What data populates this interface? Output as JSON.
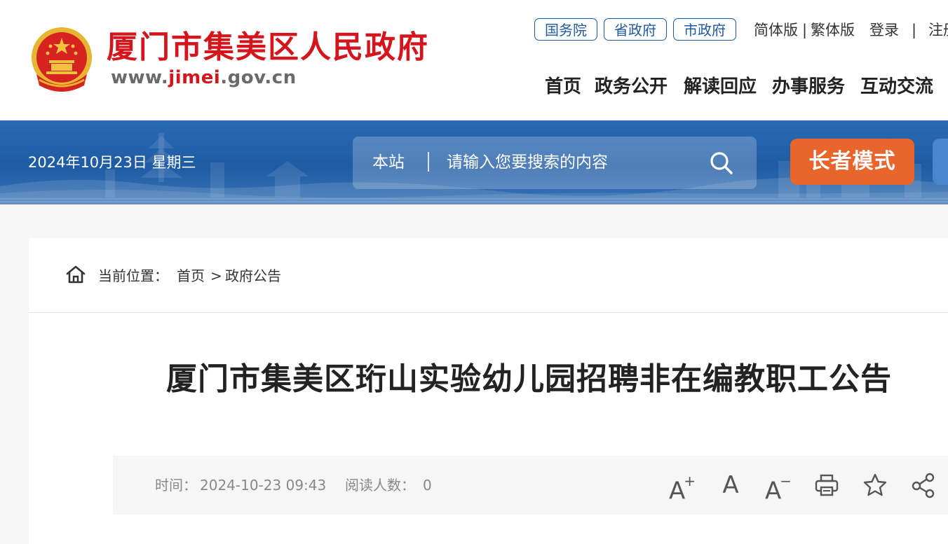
{
  "header": {
    "site_name": "厦门市集美区人民政府",
    "url_prefix": "www.",
    "url_highlight": "jimei",
    "url_suffix": ".gov.cn",
    "gov_links": [
      "国务院",
      "省政府",
      "市政府"
    ],
    "lang_simple": "简体版",
    "lang_sep": "|",
    "lang_traditional": "繁体版",
    "login": "登录",
    "account_sep": "|",
    "register_partial": "注册",
    "nav": [
      "首页",
      "政务公开",
      "解读回应",
      "办事服务",
      "互动交流"
    ]
  },
  "banner": {
    "date": "2024年10月23日 星期三",
    "search_scope": "本站",
    "search_placeholder": "请输入您要搜索的内容",
    "elder_mode": "长者模式"
  },
  "breadcrumb": {
    "label": "当前位置：",
    "items": [
      "首页",
      "政府公告"
    ],
    "separator": ">"
  },
  "article": {
    "title": "厦门市集美区珩山实验幼儿园招聘非在编教职工公告",
    "time_label": "时间：",
    "time_value": "2024-10-23 09:43",
    "reads_label": "阅读人数：",
    "reads_value": "0"
  },
  "tools": {
    "font_large": "A",
    "font_large_mark": "+",
    "font_normal": "A",
    "font_small": "A",
    "font_small_mark": "−"
  },
  "colors": {
    "brand_red": "#d4161c",
    "gov_blue": "#1e5a9f",
    "banner_blue": "#1e5ba3",
    "elder_orange": "#e8652c"
  }
}
